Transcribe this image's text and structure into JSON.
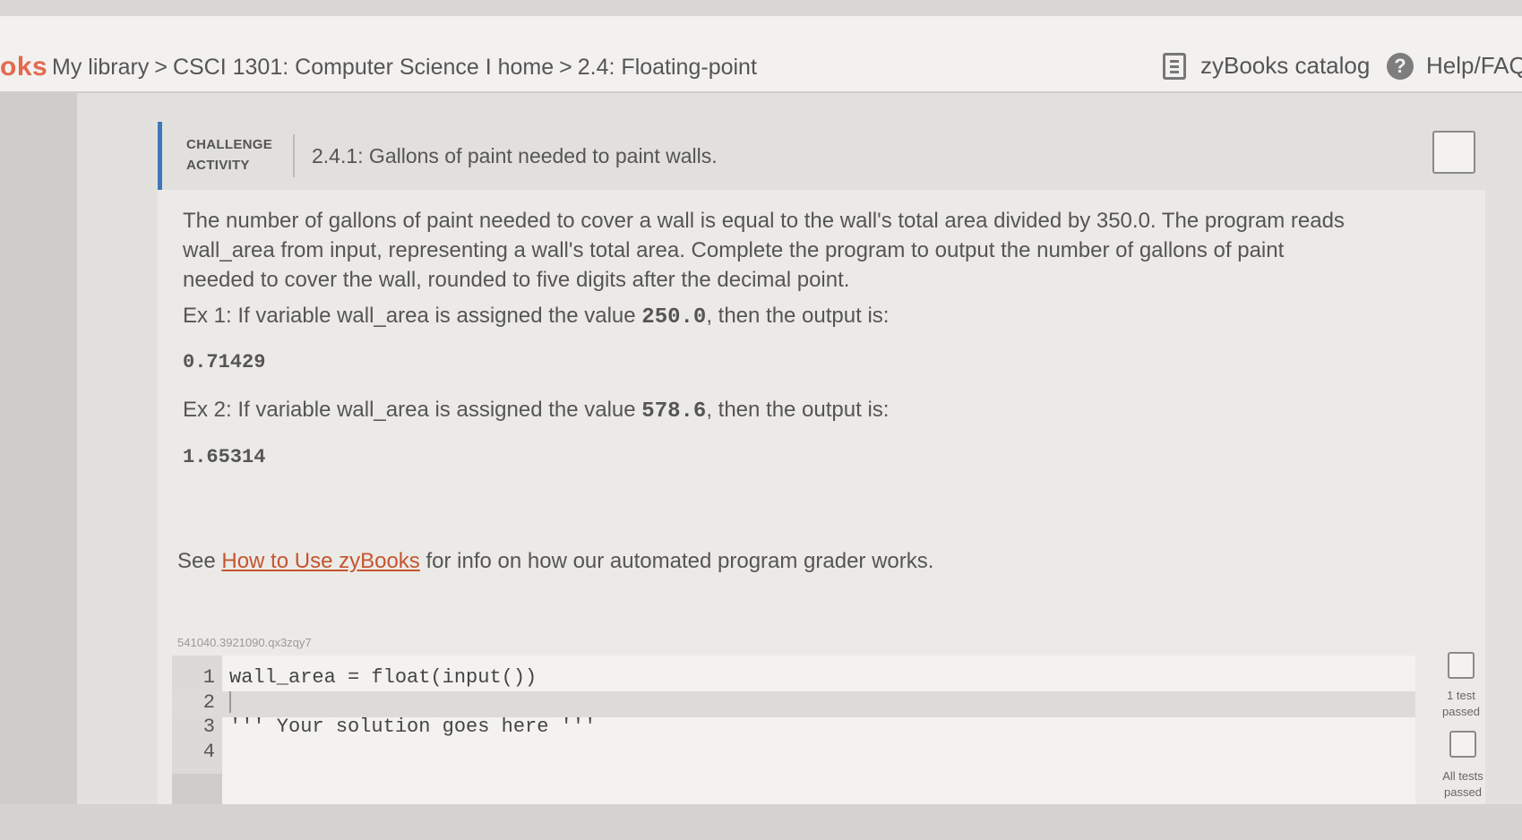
{
  "header": {
    "brand": "oks",
    "breadcrumbs": [
      "My library",
      "CSCI 1301: Computer Science I home",
      "2.4: Floating-point"
    ],
    "breadcrumb_sep": ">",
    "catalog_label": "zyBooks catalog",
    "catalog_icon": "book-icon",
    "help_label": "Help/FAQ",
    "help_icon": "question-icon"
  },
  "activity": {
    "type_line1": "CHALLENGE",
    "type_line2": "ACTIVITY",
    "title": "2.4.1: Gallons of paint needed to paint walls.",
    "description": "The number of gallons of paint needed to cover a wall is equal to the wall's total area divided by 350.0. The program reads wall_area from input, representing a wall's total area. Complete the program to output the number of gallons of paint needed to cover the wall, rounded to five digits after the decimal point.",
    "ex1_prefix": "Ex 1: If variable wall_area is assigned the value ",
    "ex1_value": "250.0",
    "ex1_suffix": ", then the output is:",
    "ex1_output": "0.71429",
    "ex2_prefix": "Ex 2: If variable wall_area is assigned the value ",
    "ex2_value": "578.6",
    "ex2_suffix": ", then the output is:",
    "ex2_output": "1.65314",
    "see_prefix": "See ",
    "see_link": "How to Use zyBooks",
    "see_suffix": " for info on how our automated program grader works.",
    "code_id": "541040.3921090.qx3zqy7"
  },
  "editor": {
    "lines": [
      {
        "num": "1",
        "code": "wall_area = float(input())"
      },
      {
        "num": "2",
        "code": ""
      },
      {
        "num": "3",
        "code": "''' Your solution goes here '''"
      },
      {
        "num": "4",
        "code": ""
      }
    ]
  },
  "tests": {
    "one_test_line1": "1 test",
    "one_test_line2": "passed",
    "all_tests_line1": "All tests",
    "all_tests_line2": "passed"
  }
}
